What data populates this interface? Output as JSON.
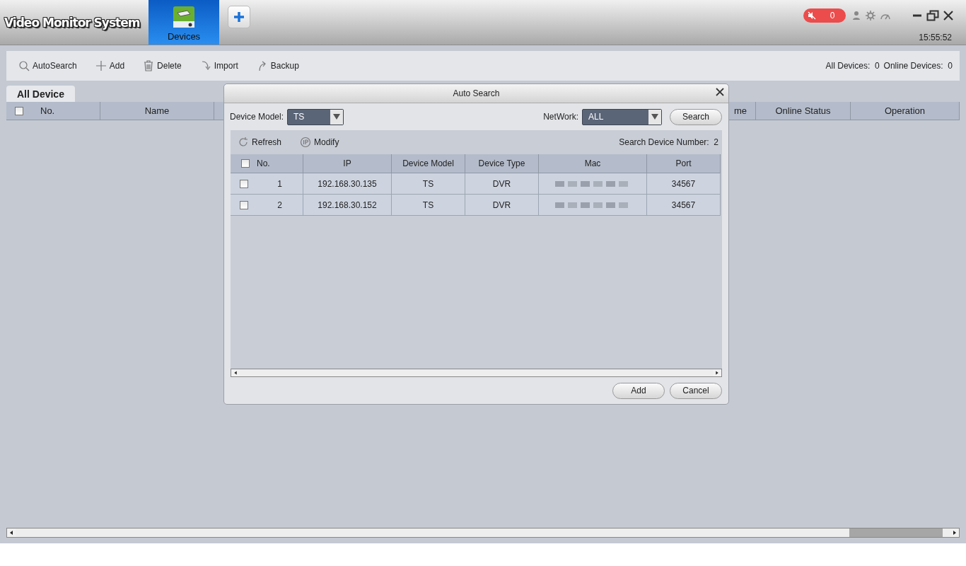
{
  "app": {
    "title": "Video Monitor System",
    "nav_tabs": [
      {
        "label": "Devices",
        "selected": true
      }
    ],
    "alarm_count": "0",
    "time": "15:55:52"
  },
  "toolbar": {
    "actions": [
      {
        "kind": "search",
        "label": "AutoSearch"
      },
      {
        "kind": "add",
        "label": "Add"
      },
      {
        "kind": "delete",
        "label": "Delete"
      },
      {
        "kind": "import",
        "label": "Import"
      },
      {
        "kind": "backup",
        "label": "Backup"
      }
    ],
    "stats": [
      {
        "label": "All Devices:",
        "value": "0"
      },
      {
        "label": "Online Devices:",
        "value": "0"
      }
    ]
  },
  "device_tabs": [
    {
      "label": "All Device",
      "selected": true
    }
  ],
  "device_table": {
    "select_all_checked": false,
    "columns": [
      "No.",
      "Name",
      "me",
      "Online Status",
      "Operation"
    ]
  },
  "dialog": {
    "title": "Auto Search",
    "device_model": {
      "label": "Device Model:",
      "value": "TS"
    },
    "network": {
      "label": "NetWork:",
      "value": "ALL"
    },
    "search_button": "Search",
    "actions": [
      {
        "kind": "refresh",
        "label": "Refresh"
      },
      {
        "kind": "ip",
        "label": "Modify"
      }
    ],
    "count_label": "Search Device Number:",
    "count": "2",
    "select_all_checked": false,
    "columns": [
      "No.",
      "IP",
      "Device Model",
      "Device Type",
      "Mac",
      "Port"
    ],
    "rows": [
      {
        "checked": false,
        "no": "1",
        "ip": "192.168.30.135",
        "model": "TS",
        "type": "DVR",
        "port": "34567"
      },
      {
        "checked": false,
        "no": "2",
        "ip": "192.168.30.152",
        "model": "TS",
        "type": "DVR",
        "port": "34567"
      }
    ],
    "buttons": [
      "Add",
      "Cancel"
    ]
  }
}
